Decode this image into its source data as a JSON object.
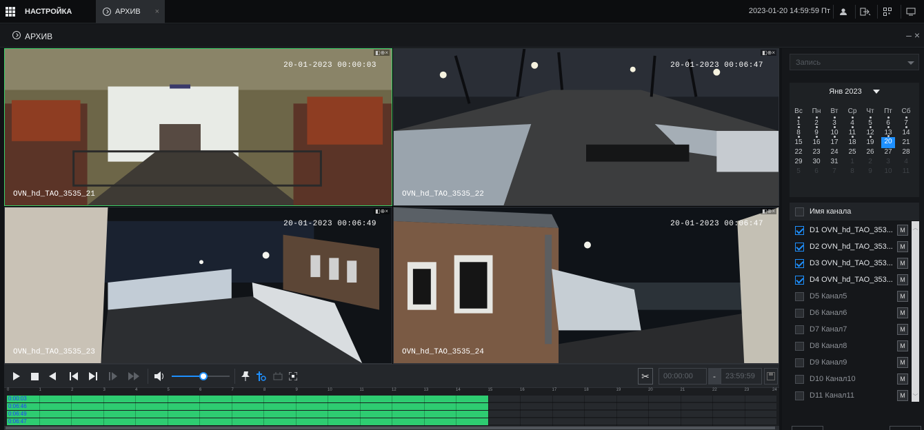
{
  "topbar": {
    "home_tab": "НАСТРОЙКА",
    "archive_tab": "АРХИВ",
    "close_glyph": "×",
    "datetime": "2023-01-20 14:59:59 Пт",
    "icons": [
      "user-icon",
      "logout-icon",
      "qr-icon",
      "fullscreen-icon"
    ]
  },
  "titlebar": {
    "title": "АРХИВ",
    "controls": "– ×"
  },
  "panes": [
    {
      "time": "20-01-2023 00:00:03",
      "name": "OVN_hd_TAO_3535_21",
      "tools": "◧⊕×"
    },
    {
      "time": "20-01-2023 00:06:47",
      "name": "OVN_hd_TAO_3535_22",
      "tools": "◧⊕×"
    },
    {
      "time": "20-01-2023 00:06:49",
      "name": "OVN_hd_TAO_3535_23",
      "tools": "◧⊕×"
    },
    {
      "time": "20-01-2023 00:06:47",
      "name": "OVN_hd_TAO_3535_24",
      "tools": "◧⊕×"
    }
  ],
  "controls": {
    "volume_level": 0.55,
    "start_time": "00:00:00",
    "dash": "-",
    "end_time": "23:59:59"
  },
  "timeline": {
    "hours": [
      "0",
      "1",
      "2",
      "3",
      "4",
      "5",
      "6",
      "7",
      "8",
      "9",
      "10",
      "11",
      "12",
      "13",
      "14",
      "15",
      "16",
      "17",
      "18",
      "19",
      "20",
      "21",
      "22",
      "23",
      "24"
    ],
    "rows": [
      {
        "label": "0:00:03",
        "record_until_hour": 15
      },
      {
        "label": "0:06:46",
        "record_until_hour": 15
      },
      {
        "label": "0:06:49",
        "record_until_hour": 15
      },
      {
        "label": "0:06:47",
        "record_until_hour": 15
      }
    ]
  },
  "right": {
    "record_type_placeholder": "Запись",
    "calendar": {
      "month": "Янв 2023",
      "dow": [
        "Вс",
        "Пн",
        "Вт",
        "Ср",
        "Чт",
        "Пт",
        "Сб"
      ],
      "weeks": [
        [
          "1",
          "2",
          "3",
          "4",
          "5",
          "6",
          "7"
        ],
        [
          "8",
          "9",
          "10",
          "11",
          "12",
          "13",
          "14"
        ],
        [
          "15",
          "16",
          "17",
          "18",
          "19",
          "20",
          "21"
        ],
        [
          "22",
          "23",
          "24",
          "25",
          "26",
          "27",
          "28"
        ],
        [
          "29",
          "30",
          "31",
          "1",
          "2",
          "3",
          "4"
        ],
        [
          "5",
          "6",
          "7",
          "8",
          "9",
          "10",
          "11"
        ]
      ],
      "selected": "20"
    },
    "channel_header": "Имя канала",
    "channels": [
      {
        "name": "D1 OVN_hd_TAO_353...",
        "checked": true,
        "m": "M"
      },
      {
        "name": "D2 OVN_hd_TAO_353...",
        "checked": true,
        "m": "M"
      },
      {
        "name": "D3 OVN_hd_TAO_353...",
        "checked": true,
        "m": "M"
      },
      {
        "name": "D4 OVN_hd_TAO_353...",
        "checked": true,
        "m": "M"
      },
      {
        "name": "D5 Канал5",
        "checked": false,
        "m": "M"
      },
      {
        "name": "D6 Канал6",
        "checked": false,
        "m": "M"
      },
      {
        "name": "D7 Канал7",
        "checked": false,
        "m": "M"
      },
      {
        "name": "D8 Канал8",
        "checked": false,
        "m": "M"
      },
      {
        "name": "D9 Канал9",
        "checked": false,
        "m": "M"
      },
      {
        "name": "D10 Канал10",
        "checked": false,
        "m": "M"
      },
      {
        "name": "D11 Канал11",
        "checked": false,
        "m": "M"
      }
    ]
  },
  "colors": {
    "accent": "#1e90ff",
    "record": "#2ecc71",
    "active_pane": "#3dd36b"
  }
}
